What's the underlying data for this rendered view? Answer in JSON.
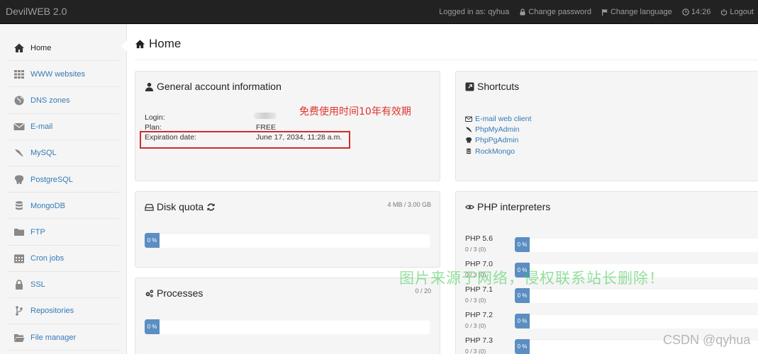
{
  "app": {
    "brand": "DevilWEB 2.0"
  },
  "topnav": {
    "logged_in": "Logged in as: qyhua",
    "change_password": "Change password",
    "change_language": "Change language",
    "time": "14:26",
    "logout": "Logout"
  },
  "sidebar": {
    "items": [
      {
        "label": "Home",
        "icon": "home-icon"
      },
      {
        "label": "WWW websites",
        "icon": "grid-icon"
      },
      {
        "label": "DNS zones",
        "icon": "globe-icon"
      },
      {
        "label": "E-mail",
        "icon": "envelope-icon"
      },
      {
        "label": "MySQL",
        "icon": "dolphin-icon"
      },
      {
        "label": "PostgreSQL",
        "icon": "elephant-icon"
      },
      {
        "label": "MongoDB",
        "icon": "database-icon"
      },
      {
        "label": "FTP",
        "icon": "folder-icon"
      },
      {
        "label": "Cron jobs",
        "icon": "calendar-icon"
      },
      {
        "label": "SSL",
        "icon": "lock-icon"
      },
      {
        "label": "Repositories",
        "icon": "branch-icon"
      },
      {
        "label": "File manager",
        "icon": "folder-open-icon"
      }
    ]
  },
  "main": {
    "title": "Home",
    "general": {
      "title": "General account information",
      "login_label": "Login:",
      "plan_label": "Plan:",
      "plan_value": "FREE",
      "expiration_label": "Expiration date:",
      "expiration_value": "June 17, 2034, 11:28 a.m.",
      "annotation": "免费使用时间10年有效期"
    },
    "shortcuts": {
      "title": "Shortcuts",
      "links": [
        "E-mail web client",
        "PhpMyAdmin",
        "PhpPgAdmin",
        "RockMongo"
      ]
    },
    "disk": {
      "title": "Disk quota",
      "usage": "4 MB / 3.00 GB",
      "percent_label": "0 %",
      "percent": 0
    },
    "processes": {
      "title": "Processes",
      "count": "0 / 20",
      "percent_label": "0 %",
      "percent": 0
    },
    "php": {
      "title": "PHP interpreters",
      "rows": [
        {
          "name": "PHP 5.6",
          "count": "0 / 3 (0)",
          "percent_label": "0 %"
        },
        {
          "name": "PHP 7.0",
          "count": "0 / 3 (0)",
          "percent_label": "0 %"
        },
        {
          "name": "PHP 7.1",
          "count": "0 / 3 (0)",
          "percent_label": "0 %"
        },
        {
          "name": "PHP 7.2",
          "count": "0 / 3 (0)",
          "percent_label": "0 %"
        },
        {
          "name": "PHP 7.3",
          "count": "0 / 3 (0)",
          "percent_label": "0 %"
        }
      ]
    }
  },
  "watermarks": {
    "cn": "图片来源于网络，侵权联系站长删除！",
    "csdn": "CSDN @qyhua"
  },
  "colors": {
    "topbar": "#222222",
    "link": "#337ab7",
    "progress": "#5b8ec2",
    "annotation_red": "#d22b2b"
  }
}
